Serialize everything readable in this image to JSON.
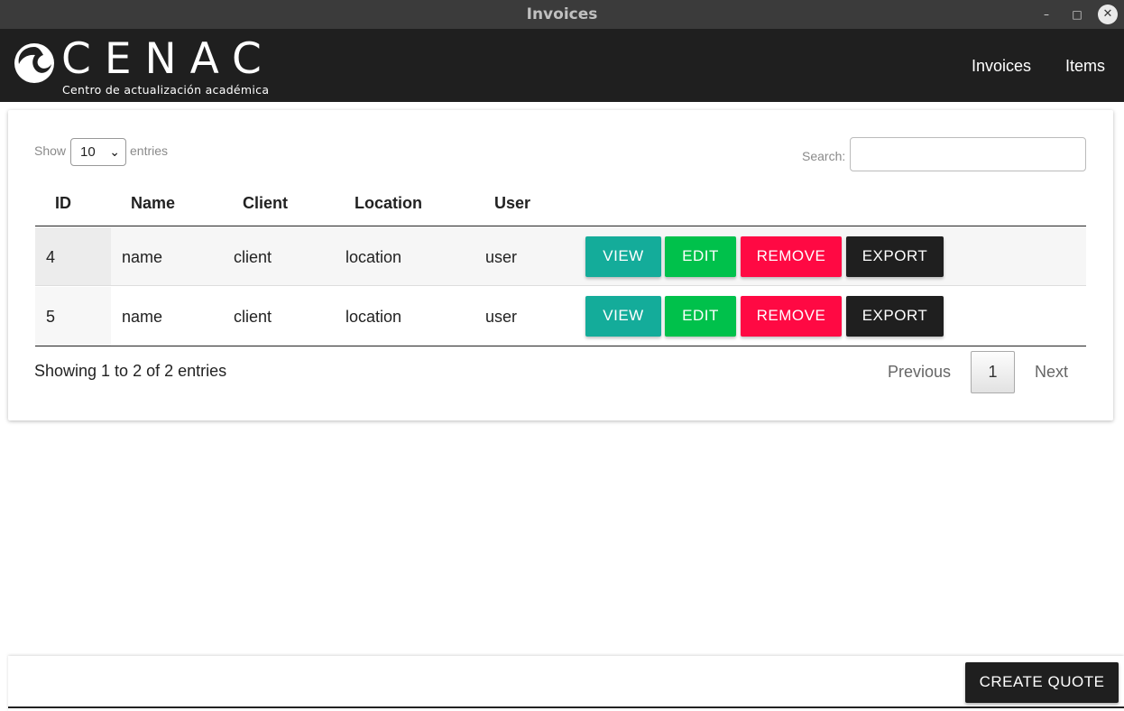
{
  "window": {
    "title": "Invoices",
    "minimize": "–",
    "maximize": "□",
    "close": "✕"
  },
  "header": {
    "logo_text": "CENAC",
    "logo_subtitle": "Centro de actualización académica",
    "nav": [
      "Invoices",
      "Items"
    ]
  },
  "controls": {
    "show_label": "Show",
    "entries_value": "10",
    "entries_label": "entries",
    "search_label": "Search:",
    "search_value": ""
  },
  "table": {
    "columns": [
      "ID",
      "Name",
      "Client",
      "Location",
      "User"
    ],
    "rows": [
      {
        "id": "4",
        "name": "name",
        "client": "client",
        "location": "location",
        "user": "user"
      },
      {
        "id": "5",
        "name": "name",
        "client": "client",
        "location": "location",
        "user": "user"
      }
    ],
    "actions": {
      "view": "VIEW",
      "edit": "EDIT",
      "remove": "REMOVE",
      "export": "EXPORT"
    }
  },
  "pagination": {
    "info": "Showing 1 to 2 of 2 entries",
    "previous": "Previous",
    "current": "1",
    "next": "Next"
  },
  "footer": {
    "create_quote": "CREATE QUOTE"
  },
  "colors": {
    "view": "#14ac9a",
    "edit": "#00c14b",
    "remove": "#ff0943",
    "export": "#1f1f1f",
    "header_bg": "#1f1f1f"
  }
}
